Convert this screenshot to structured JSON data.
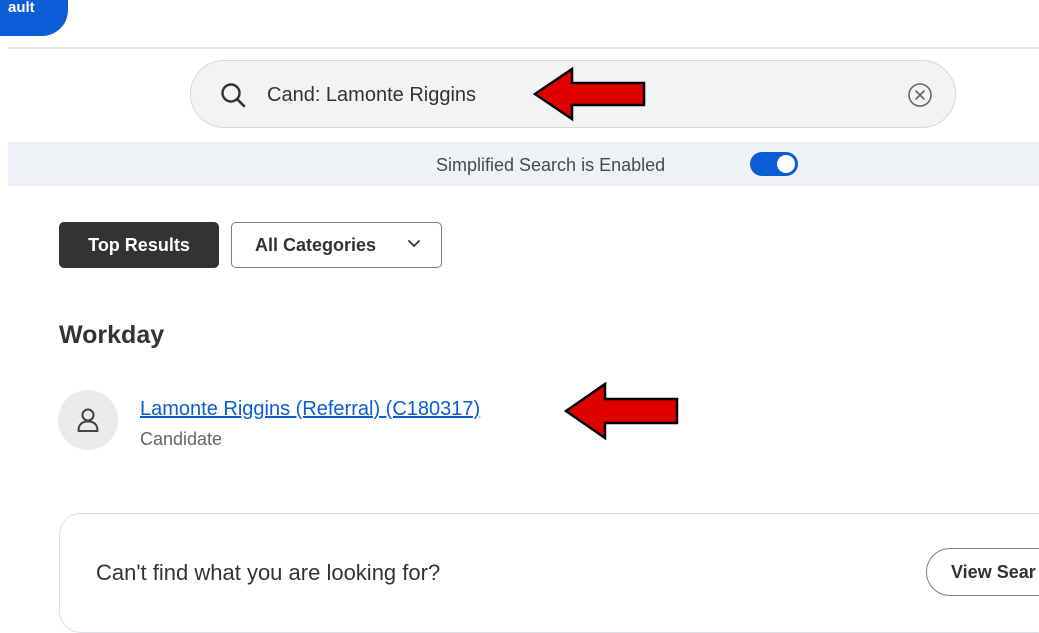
{
  "header": {
    "tab_fragment": "ault"
  },
  "search": {
    "value": "Cand: Lamonte Riggins",
    "search_icon": "search-icon",
    "clear_icon": "clear-circle-x-icon"
  },
  "simplified_search": {
    "label": "Simplified Search is Enabled",
    "enabled": true
  },
  "filters": {
    "top_results_label": "Top Results",
    "all_categories_label": "All Categories"
  },
  "results": {
    "section_title": "Workday",
    "items": [
      {
        "title": "Lamonte Riggins (Referral) (C180317)",
        "subtitle": "Candidate",
        "icon": "person-icon"
      }
    ]
  },
  "help_card": {
    "text": "Can't find what you are looking for?",
    "button_label": "View Sear"
  },
  "colors": {
    "accent": "#0b5cd5",
    "annotation_arrow": "#e00000",
    "dark_button": "#333333"
  }
}
